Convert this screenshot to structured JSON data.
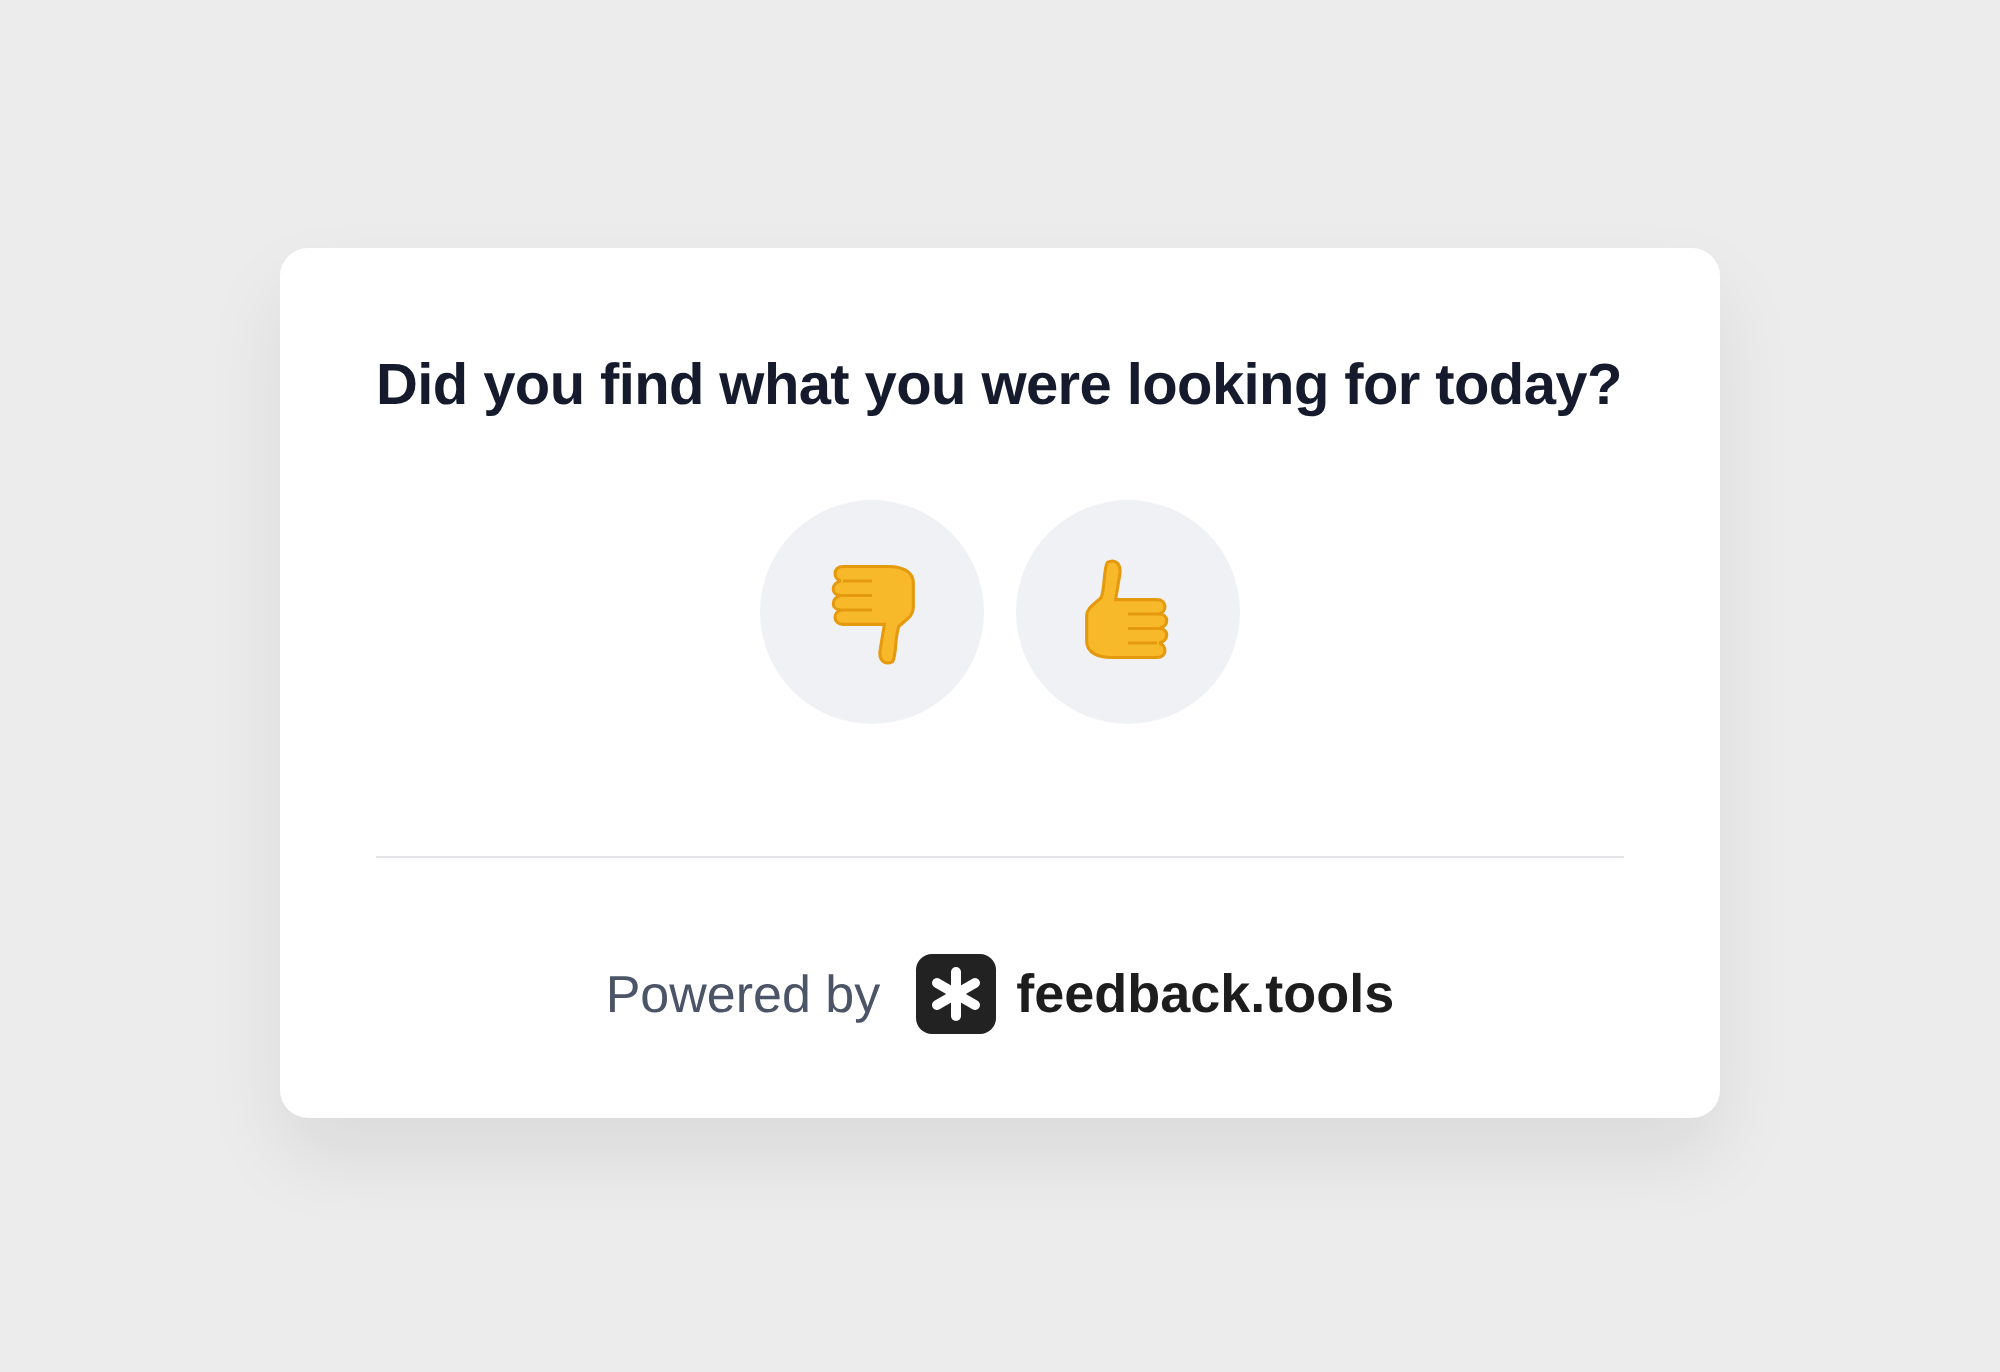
{
  "question": "Did you find what you were looking for today?",
  "reactions": [
    {
      "kind": "thumbs_down"
    },
    {
      "kind": "thumbs_up"
    }
  ],
  "footer": {
    "prefix": "Powered by",
    "brand": "feedback.tools"
  }
}
